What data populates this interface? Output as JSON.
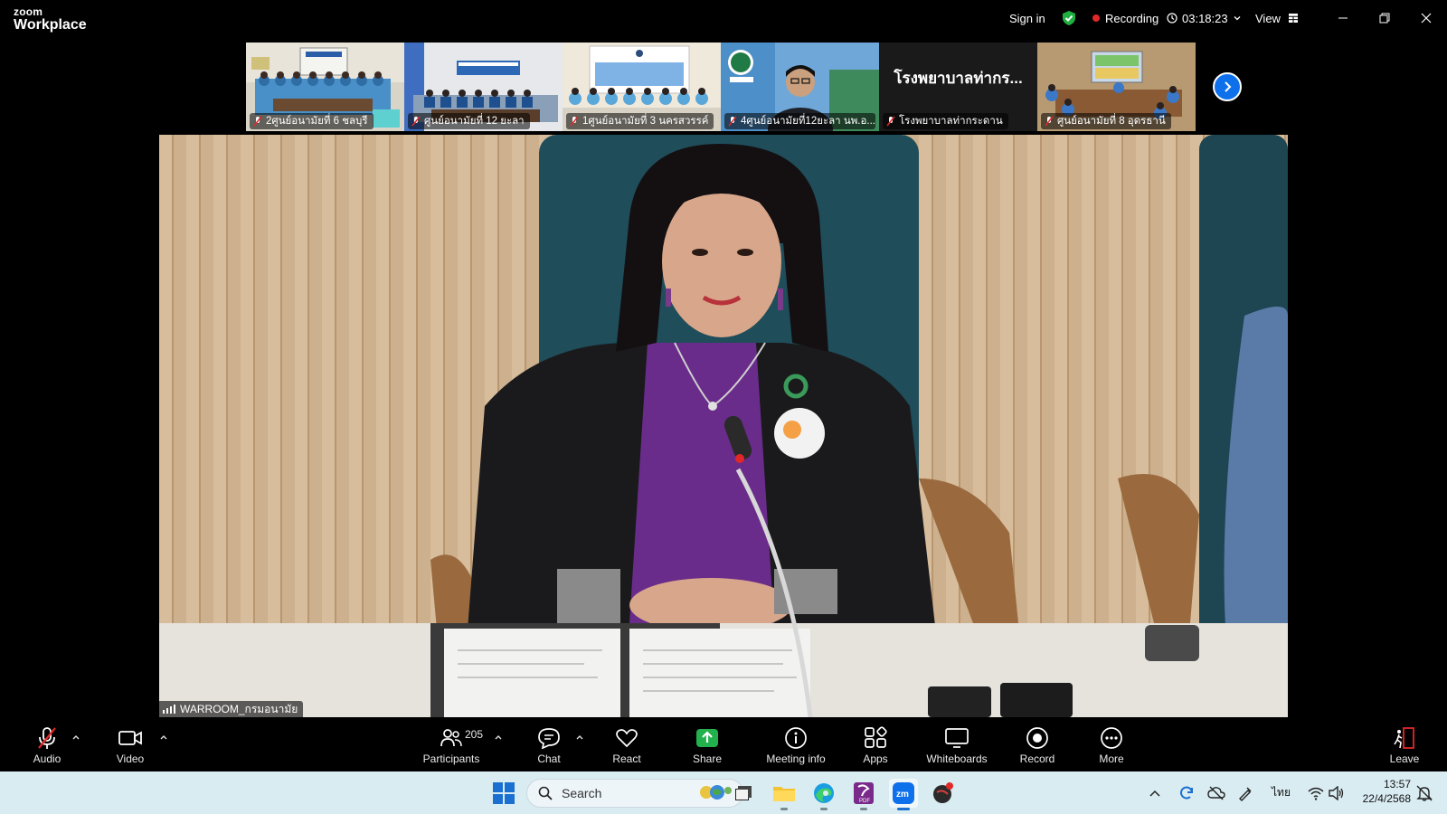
{
  "app": {
    "brand_top": "zoom",
    "brand_bottom": "Workplace",
    "sign_in": "Sign in",
    "recording": "Recording",
    "timer": "03:18:23",
    "view": "View"
  },
  "thumbnails": [
    {
      "label": "2ศูนย์อนามัยที่ 6 ชลบุรี",
      "type": "room-blue"
    },
    {
      "label": "ศูนย์อนามัยที่ 12 ยะลา",
      "type": "room-white"
    },
    {
      "label": "1ศูนย์อนามัยที่ 3 นครสวรรค์",
      "type": "room-stage"
    },
    {
      "label": "4ศูนย์อนามัยที่12ยะลา นพ.อ...",
      "type": "person"
    },
    {
      "label": "โรงพยาบาลท่ากระดาน",
      "type": "name",
      "name_display": "โรงพยาบาลท่ากร..."
    },
    {
      "label": "ศูนย์อนามัยที่ 8 อุดรธานี",
      "type": "room-screen"
    }
  ],
  "main_video": {
    "speaker_label": "WARROOM_กรมอนามัย"
  },
  "toolbar": {
    "audio": "Audio",
    "video": "Video",
    "participants": "Participants",
    "participants_count": "205",
    "chat": "Chat",
    "react": "React",
    "share": "Share",
    "meeting_info": "Meeting info",
    "apps": "Apps",
    "whiteboards": "Whiteboards",
    "record": "Record",
    "more": "More",
    "leave": "Leave"
  },
  "taskbar": {
    "search_placeholder": "Search",
    "language": "ไทย",
    "time": "13:57",
    "date": "22/4/2568"
  },
  "colors": {
    "accent_blue": "#0e71eb",
    "recording_red": "#e02828",
    "share_green": "#22b14c",
    "shield_green": "#1fb041"
  }
}
